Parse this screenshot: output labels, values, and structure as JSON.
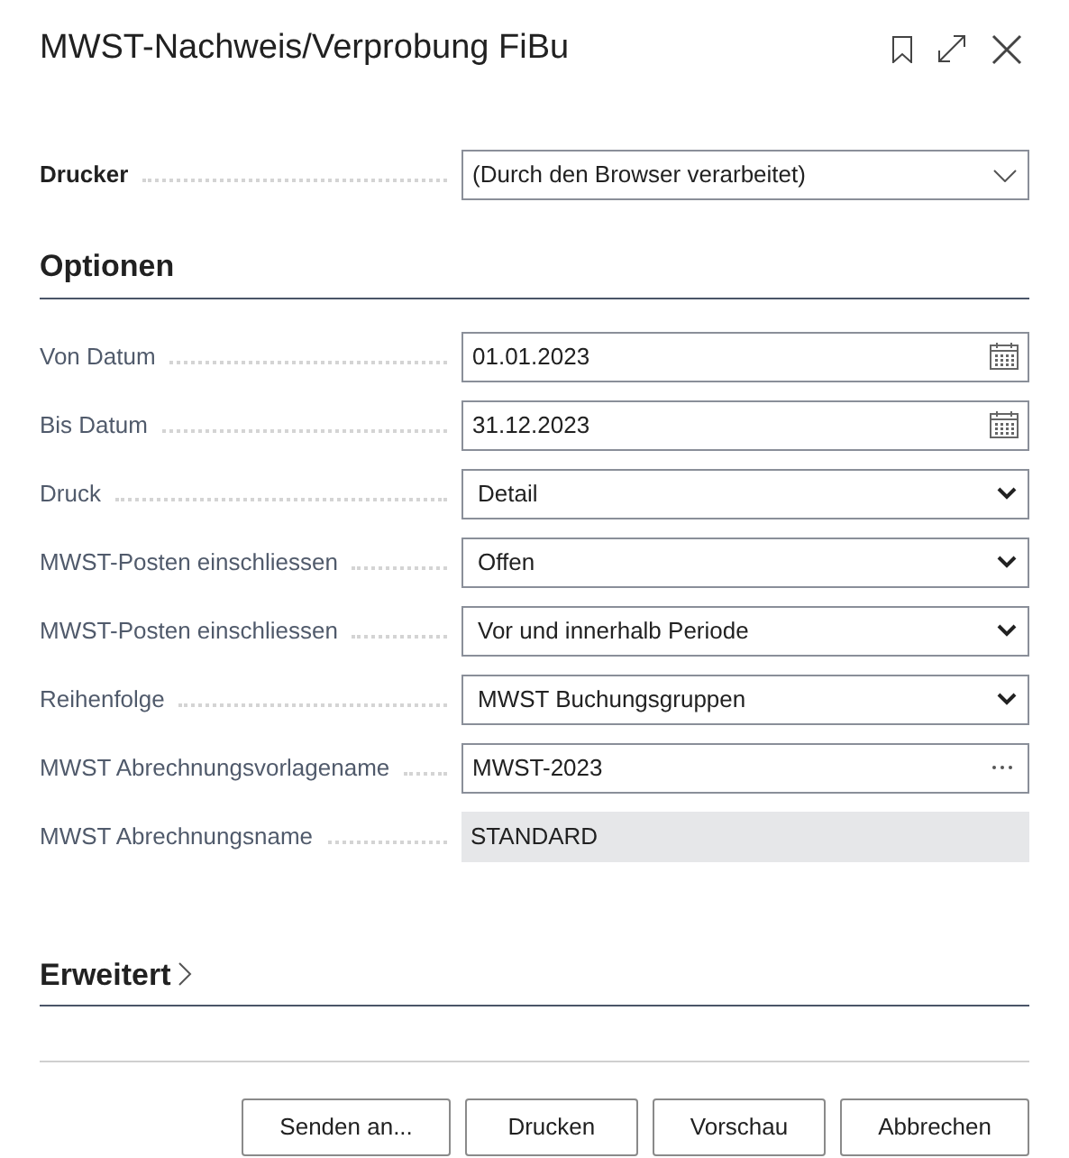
{
  "window": {
    "title": "MWST-Nachweis/Verprobung FiBu"
  },
  "printer": {
    "label": "Drucker",
    "value": "(Durch den Browser verarbeitet)"
  },
  "options": {
    "title": "Optionen",
    "fields": [
      {
        "label": "Von Datum",
        "kind": "date",
        "value": "01.01.2023"
      },
      {
        "label": "Bis Datum",
        "kind": "date",
        "value": "31.12.2023"
      },
      {
        "label": "Druck",
        "kind": "select",
        "value": "Detail"
      },
      {
        "label": "MWST-Posten einschliessen",
        "kind": "select",
        "value": "Offen"
      },
      {
        "label": "MWST-Posten einschliessen",
        "kind": "select",
        "value": "Vor und innerhalb Periode"
      },
      {
        "label": "Reihenfolge",
        "kind": "select",
        "value": "MWST Buchungsgruppen"
      },
      {
        "label": "MWST Abrechnungsvorlagename",
        "kind": "lookup",
        "value": "MWST-2023"
      },
      {
        "label": "MWST Abrechnungsname",
        "kind": "readonly",
        "value": "STANDARD"
      }
    ]
  },
  "advanced": {
    "title": "Erweitert",
    "expanded": false
  },
  "buttons": [
    "Senden an...",
    "Drucken",
    "Vorschau",
    "Abbrechen"
  ]
}
